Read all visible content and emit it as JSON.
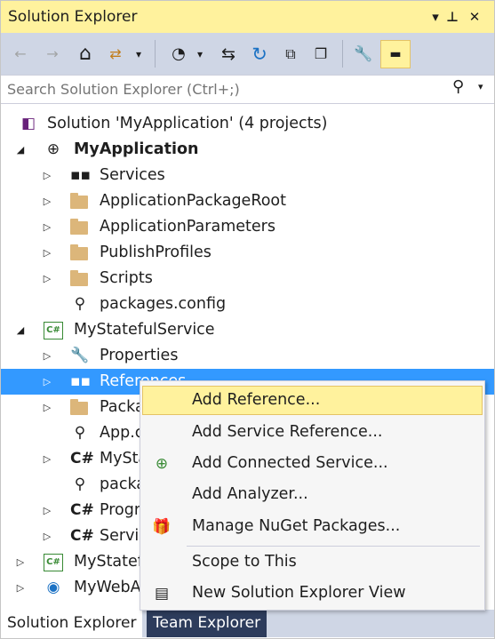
{
  "window": {
    "title": "Solution Explorer",
    "dropdown_glyph": "▾",
    "pin_glyph": "⊥",
    "close_glyph": "✕"
  },
  "toolbar": {
    "back_glyph": "←",
    "forward_glyph": "→",
    "home_glyph": "⌂",
    "switch_views_glyph": "⇄",
    "dropdown_glyph": "▾",
    "pending_changes_glyph": "◔",
    "sync_glyph": "⇆",
    "refresh_glyph": "↻",
    "collapse_all_glyph": "⧉",
    "show_all_files_glyph": "❐",
    "properties_glyph": "🔧",
    "preview_glyph": "▬"
  },
  "search": {
    "placeholder": "Search Solution Explorer (Ctrl+;)",
    "icon_glyph": "⚲",
    "dropdown_glyph": "▾"
  },
  "tree": {
    "rows": [
      {
        "label": "Solution 'MyApplication' (4 projects)",
        "expander": "",
        "icon": "sln"
      },
      {
        "label": "MyApplication",
        "expander": "◢",
        "icon": "globe-ico"
      },
      {
        "label": "Services",
        "expander": "▷",
        "icon": "services"
      },
      {
        "label": "ApplicationPackageRoot",
        "expander": "▷",
        "icon": "folder"
      },
      {
        "label": "ApplicationParameters",
        "expander": "▷",
        "icon": "folder"
      },
      {
        "label": "PublishProfiles",
        "expander": "▷",
        "icon": "folder"
      },
      {
        "label": "Scripts",
        "expander": "▷",
        "icon": "folder"
      },
      {
        "label": "packages.config",
        "expander": "",
        "icon": "config"
      },
      {
        "label": "MyStatefulService",
        "expander": "◢",
        "icon": "csproj"
      },
      {
        "label": "Properties",
        "expander": "▷",
        "icon": "wrench"
      },
      {
        "label": "References",
        "expander": "▷",
        "icon": "references"
      },
      {
        "label": "Packa",
        "expander": "▷",
        "icon": "folder"
      },
      {
        "label": "App.c",
        "expander": "",
        "icon": "config"
      },
      {
        "label": "MySta",
        "expander": "▷",
        "icon": "csfile"
      },
      {
        "label": "packa",
        "expander": "",
        "icon": "config"
      },
      {
        "label": "Progr",
        "expander": "▷",
        "icon": "csfile"
      },
      {
        "label": "Servic",
        "expander": "▷",
        "icon": "csfile"
      },
      {
        "label": "MyStatef",
        "expander": "▷",
        "icon": "csproj"
      },
      {
        "label": "MyWebA",
        "expander": "▷",
        "icon": "webproj"
      }
    ],
    "glyphs": {
      "services": "▪▪",
      "config": "⚲",
      "wrench": "🔧",
      "references": "▪▪",
      "csfile": "C#",
      "csproj": "C#",
      "sln": "◧",
      "globe-ico": "⊕",
      "webproj": "◉"
    }
  },
  "context_menu": {
    "items": [
      {
        "label": "Add Reference...",
        "icon": ""
      },
      {
        "label": "Add Service Reference...",
        "icon": ""
      },
      {
        "label": "Add Connected Service...",
        "icon": "⊕"
      },
      {
        "label": "Add Analyzer...",
        "icon": ""
      },
      {
        "label": "Manage NuGet Packages...",
        "icon": "🎁"
      },
      {
        "label": "Scope to This",
        "icon": ""
      },
      {
        "label": "New Solution Explorer View",
        "icon": "▤"
      }
    ]
  },
  "tabs": {
    "solution_explorer": "Solution Explorer",
    "team_explorer": "Team Explorer"
  },
  "colors": {
    "title_active": "#fff29d",
    "toolbar": "#cfd6e5",
    "selection": "#3399ff",
    "menu_highlight": "#fff29d",
    "csharp_green": "#388a34",
    "folder": "#dcb67a"
  }
}
